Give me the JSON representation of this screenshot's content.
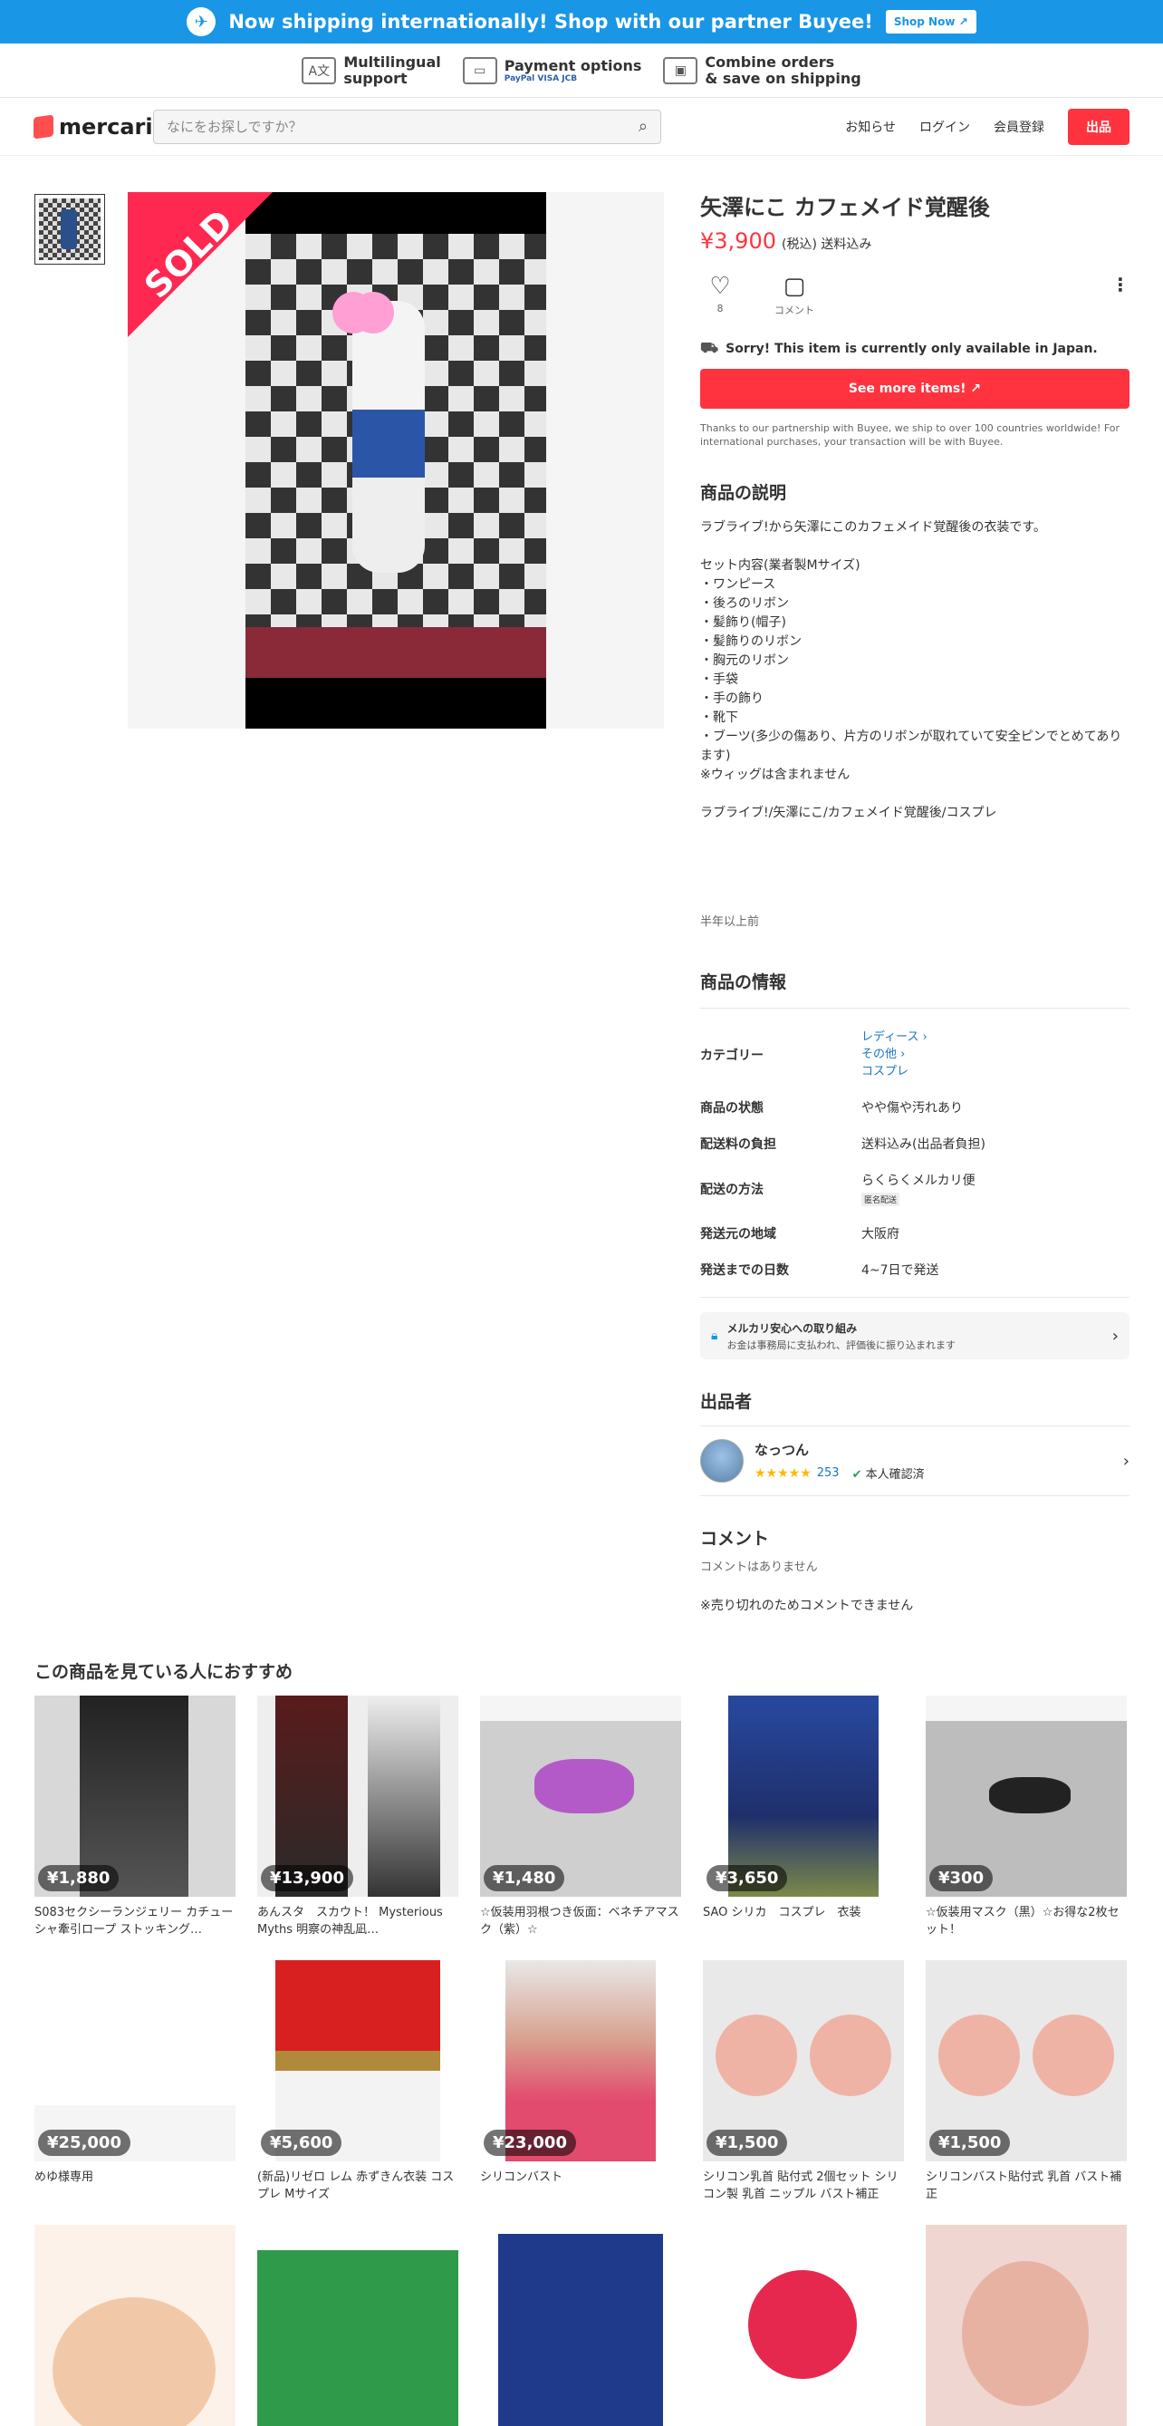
{
  "banner": {
    "text": "Now shipping internationally! Shop with our partner Buyee!",
    "button": "Shop Now"
  },
  "features": [
    {
      "title": "Multilingual",
      "sub": "support"
    },
    {
      "title": "Payment options",
      "sub": "PayPal VISA JCB"
    },
    {
      "title": "Combine orders",
      "sub": "& save on shipping"
    }
  ],
  "header": {
    "logo": "mercari",
    "search_placeholder": "なにをお探しですか？",
    "nav": {
      "news": "お知らせ",
      "login": "ログイン",
      "signup": "会員登録",
      "sell": "出品"
    }
  },
  "product": {
    "badge": "SOLD",
    "title": "矢澤にこ カフェメイド覚醒後",
    "price": "¥3,900",
    "price_note": "(税込) 送料込み",
    "likes": "8",
    "comment_label": "コメント",
    "sorry": "Sorry! This item is currently only available in Japan.",
    "see_more": "See more items!",
    "notice": "Thanks to our partnership with Buyee, we ship to over 100 countries worldwide! For international purchases, your transaction will be with Buyee.",
    "desc_heading": "商品の説明",
    "description": "ラブライブ!から矢澤にこのカフェメイド覚醒後の衣装です。\n\nセット内容(業者製Mサイズ)\n・ワンピース\n・後ろのリボン\n・髪飾り(帽子)\n・髪飾りのリボン\n・胸元のリボン\n・手袋\n・手の飾り\n・靴下\n・ブーツ(多少の傷あり、片方のリボンが取れていて安全ピンでとめてあります)\n※ウィッグは含まれません\n\nラブライブ!/矢澤にこ/カフェメイド覚醒後/コスプレ",
    "posted": "半年以上前"
  },
  "info": {
    "heading": "商品の情報",
    "category_label": "カテゴリー",
    "category": [
      "レディース",
      "その他",
      "コスプレ"
    ],
    "condition_label": "商品の状態",
    "condition": "やや傷や汚れあり",
    "fee_label": "配送料の負担",
    "fee": "送料込み(出品者負担)",
    "method_label": "配送の方法",
    "method": "らくらくメルカリ便",
    "method_tag": "匿名配送",
    "from_label": "発送元の地域",
    "from": "大阪府",
    "days_label": "発送までの日数",
    "days": "4~7日で発送"
  },
  "safety": {
    "title": "メルカリ安心への取り組み",
    "sub": "お金は事務局に支払われ、評価後に振り込まれます"
  },
  "seller": {
    "heading": "出品者",
    "name": "なっつん",
    "rating": 5,
    "count": "253",
    "verified": "本人確認済"
  },
  "comments": {
    "heading": "コメント",
    "none": "コメントはありません",
    "note": "※売り切れのためコメントできません"
  },
  "recommend": {
    "heading": "この商品を見ている人におすすめ",
    "items": [
      {
        "price": "¥1,880",
        "name": "S083セクシーランジェリー カチューシャ牽引ロープ ストッキング…"
      },
      {
        "price": "¥13,900",
        "name": "あんスタ　スカウト！ Mysterious Myths 明察の神乱凪…"
      },
      {
        "price": "¥1,480",
        "name": "☆仮装用羽根つき仮面：ベネチアマスク（紫）☆"
      },
      {
        "price": "¥3,650",
        "name": "SAO シリカ　コスプレ　衣装"
      },
      {
        "price": "¥300",
        "name": "☆仮装用マスク（黒）☆お得な2枚セット！"
      },
      {
        "price": "¥25,000",
        "name": "めゆ様専用"
      },
      {
        "price": "¥5,600",
        "name": "(新品)リゼロ レム 赤ずきん衣装 コスプレ Mサイズ"
      },
      {
        "price": "¥23,000",
        "name": "シリコンバスト"
      },
      {
        "price": "¥1,500",
        "name": "シリコン乳首 貼付式 2個セット シリコン製 乳首 ニップル バスト補正"
      },
      {
        "price": "¥1,500",
        "name": "シリコンバスト貼付式 乳首 バスト補正"
      }
    ]
  },
  "colors": {
    "brand_red": "#ff333f",
    "buyee_blue": "#1996e6",
    "link": "#1a78c2"
  }
}
